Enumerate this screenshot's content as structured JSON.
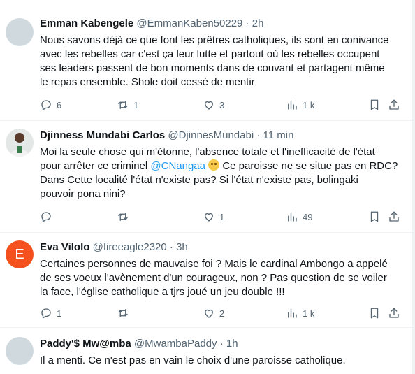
{
  "tweets": [
    {
      "name": "Emman Kabengele",
      "handle": "@EmmanKaben50229",
      "dot": "·",
      "time": "2h",
      "avatar": {
        "type": "placeholder",
        "color": "#cfd9de"
      },
      "lines": [
        "Nous savons déjà ce que font les prêtres catholiques, ils sont en conivance",
        "avec les rebelles car c'est ça leur lutte et partout où les rebelles occupent",
        "ses leaders passent de bon moments dans de couvant et partagent même",
        "le repas ensemble. Shole doit cessé de mentir"
      ],
      "replies": "6",
      "retweets": "1",
      "likes": "3",
      "views": "1 k"
    },
    {
      "name": "Djinness Mundabi Carlos",
      "handle": "@DjinnesMundabi",
      "dot": "·",
      "time": "11 min",
      "avatar": {
        "type": "photo"
      },
      "line1": "Moi la seule chose qui m'étonne, l'absence totale et l'inefficacité de l'état",
      "line2_pre": "pour arrêter ce criminel ",
      "line2_mention": "@CNangaa",
      "line2_post": " Ce paroisse ne se situe pas en RDC?",
      "line3": "Dans Cette localité l'état n'existe pas? Si l'état n'existe pas, bolingaki",
      "line4": "pouvoir pona nini?",
      "emoji": "thinking-face",
      "replies": "",
      "retweets": "",
      "likes": "1",
      "views": "49"
    },
    {
      "name": "Eva Vilolo",
      "handle": "@fireeagle2320",
      "dot": "·",
      "time": "3h",
      "avatar": {
        "type": "letter",
        "letter": "E",
        "color": "#f4511e"
      },
      "lines": [
        "Certaines personnes de mauvaise foi ? Mais le cardinal Ambongo a appelé",
        "de ses voeux l'avènement d'un courageux, non ? Pas question de se voiler",
        "la face, l'église catholique a tjrs joué un jeu double !!!"
      ],
      "replies": "1",
      "retweets": "",
      "likes": "2",
      "views": "1 k"
    },
    {
      "name": "Paddy'$ Mw@mba",
      "handle": "@MwambaPaddy",
      "dot": "·",
      "time": "1h",
      "avatar": {
        "type": "placeholder",
        "color": "#cfd9de"
      },
      "lines": [
        "Il a menti. Ce n'est pas en vain le choix d'une paroisse catholique."
      ]
    }
  ],
  "icons": [
    "reply-icon",
    "retweet-icon",
    "like-icon",
    "views-icon",
    "bookmark-icon",
    "share-icon"
  ],
  "colors": {
    "text": "#0f1419",
    "secondary": "#536471",
    "link": "#1d9bf0",
    "divider": "#eff3f4",
    "avatar_letter_bg": "#f4511e"
  }
}
